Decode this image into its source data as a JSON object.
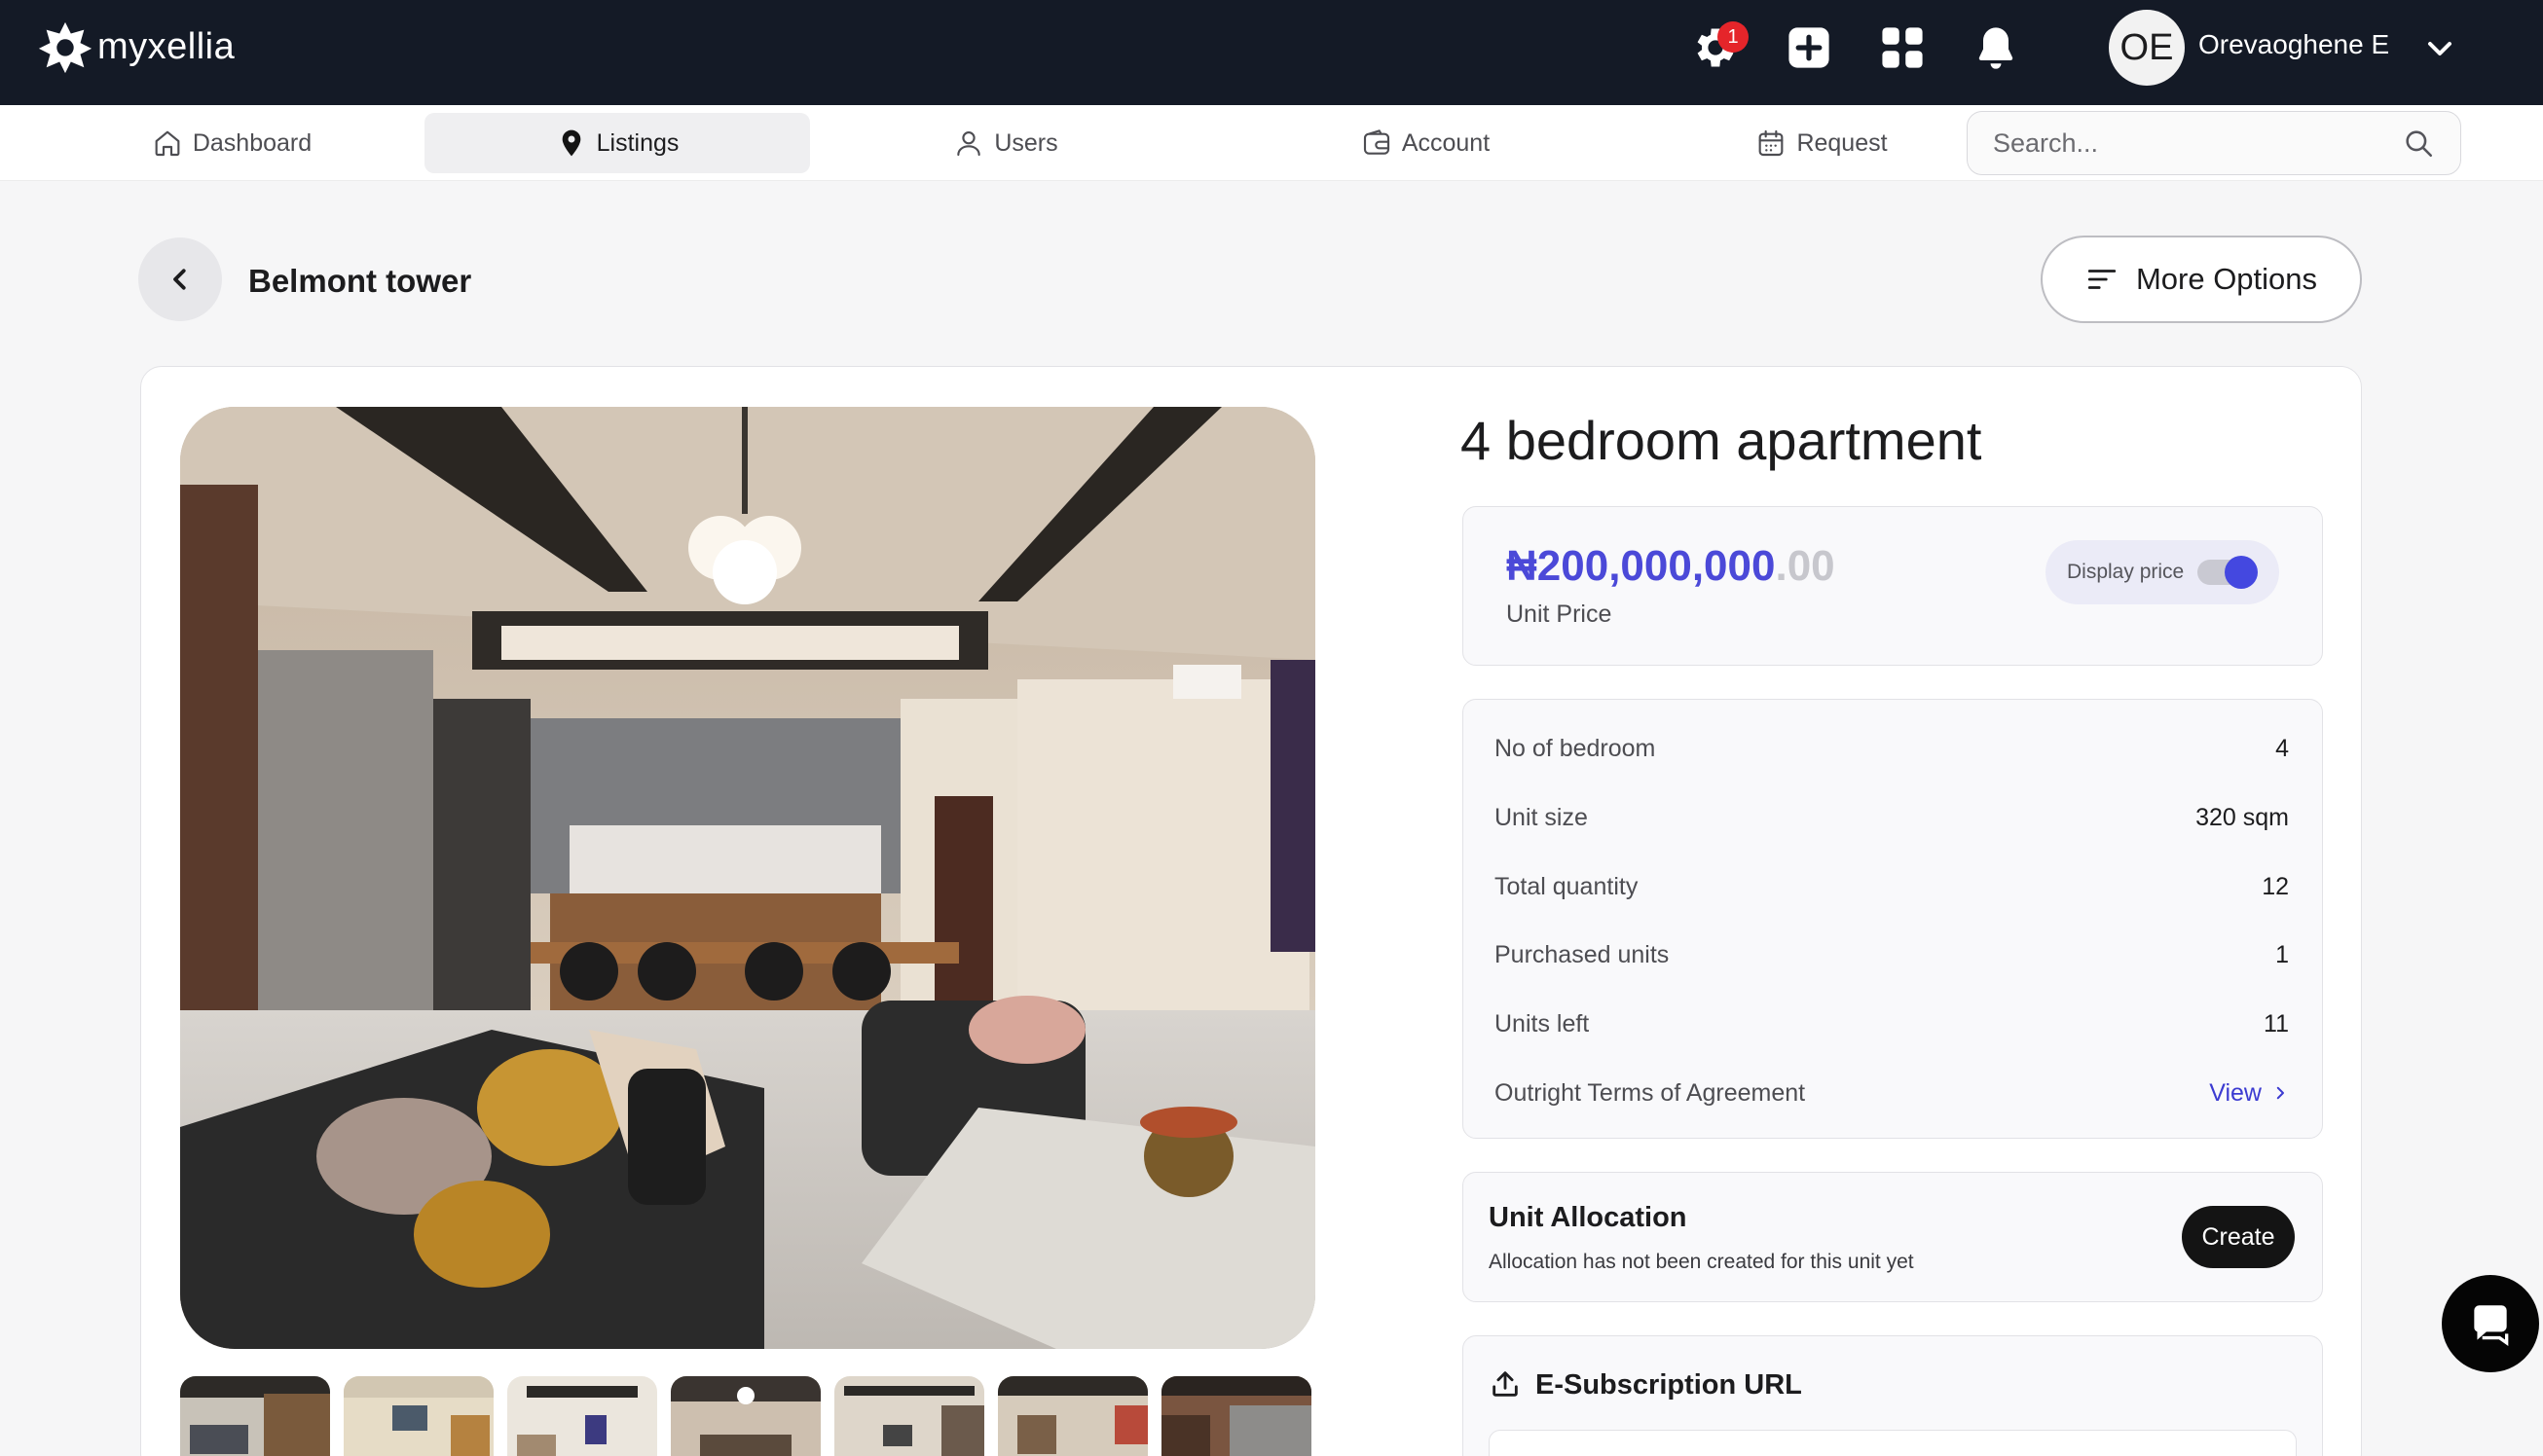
{
  "app": {
    "brand": "myxellia"
  },
  "header": {
    "settings_badge": "1",
    "user_initials": "OE",
    "user_name": "Orevaoghene E",
    "icons": [
      "settings-icon",
      "plus-square-icon",
      "apps-grid-icon",
      "bell-icon",
      "chevron-down-icon"
    ]
  },
  "nav": {
    "items": [
      {
        "label": "Dashboard",
        "icon": "home-icon"
      },
      {
        "label": "Listings",
        "icon": "map-pin-icon",
        "active": true
      },
      {
        "label": "Users",
        "icon": "user-icon"
      },
      {
        "label": "Account",
        "icon": "wallet-icon"
      },
      {
        "label": "Request",
        "icon": "calendar-icon"
      }
    ],
    "search_placeholder": "Search..."
  },
  "page": {
    "title": "Belmont tower",
    "more_options_label": "More Options"
  },
  "listing": {
    "unit_title": "4 bedroom apartment",
    "price_main": "₦200,000,000",
    "price_decimal": ".00",
    "price_label": "Unit Price",
    "display_price_label": "Display price",
    "display_price_enabled": true,
    "details": [
      {
        "label": "No of bedroom",
        "value": "4"
      },
      {
        "label": "Unit size",
        "value": "320 sqm"
      },
      {
        "label": "Total quantity",
        "value": "12"
      },
      {
        "label": "Purchased units",
        "value": "1"
      },
      {
        "label": "Units left",
        "value": "11"
      }
    ],
    "terms": {
      "label": "Outright Terms of Agreement",
      "link": "View"
    },
    "allocation": {
      "title": "Unit Allocation",
      "subtitle": "Allocation has not been created for this unit yet",
      "button": "Create"
    },
    "esubscription": {
      "title": "E-Subscription URL"
    },
    "thumbnail_count": 7
  },
  "colors": {
    "topbar": "#141a26",
    "accent": "#4b49d8",
    "badge": "#e5252a"
  }
}
